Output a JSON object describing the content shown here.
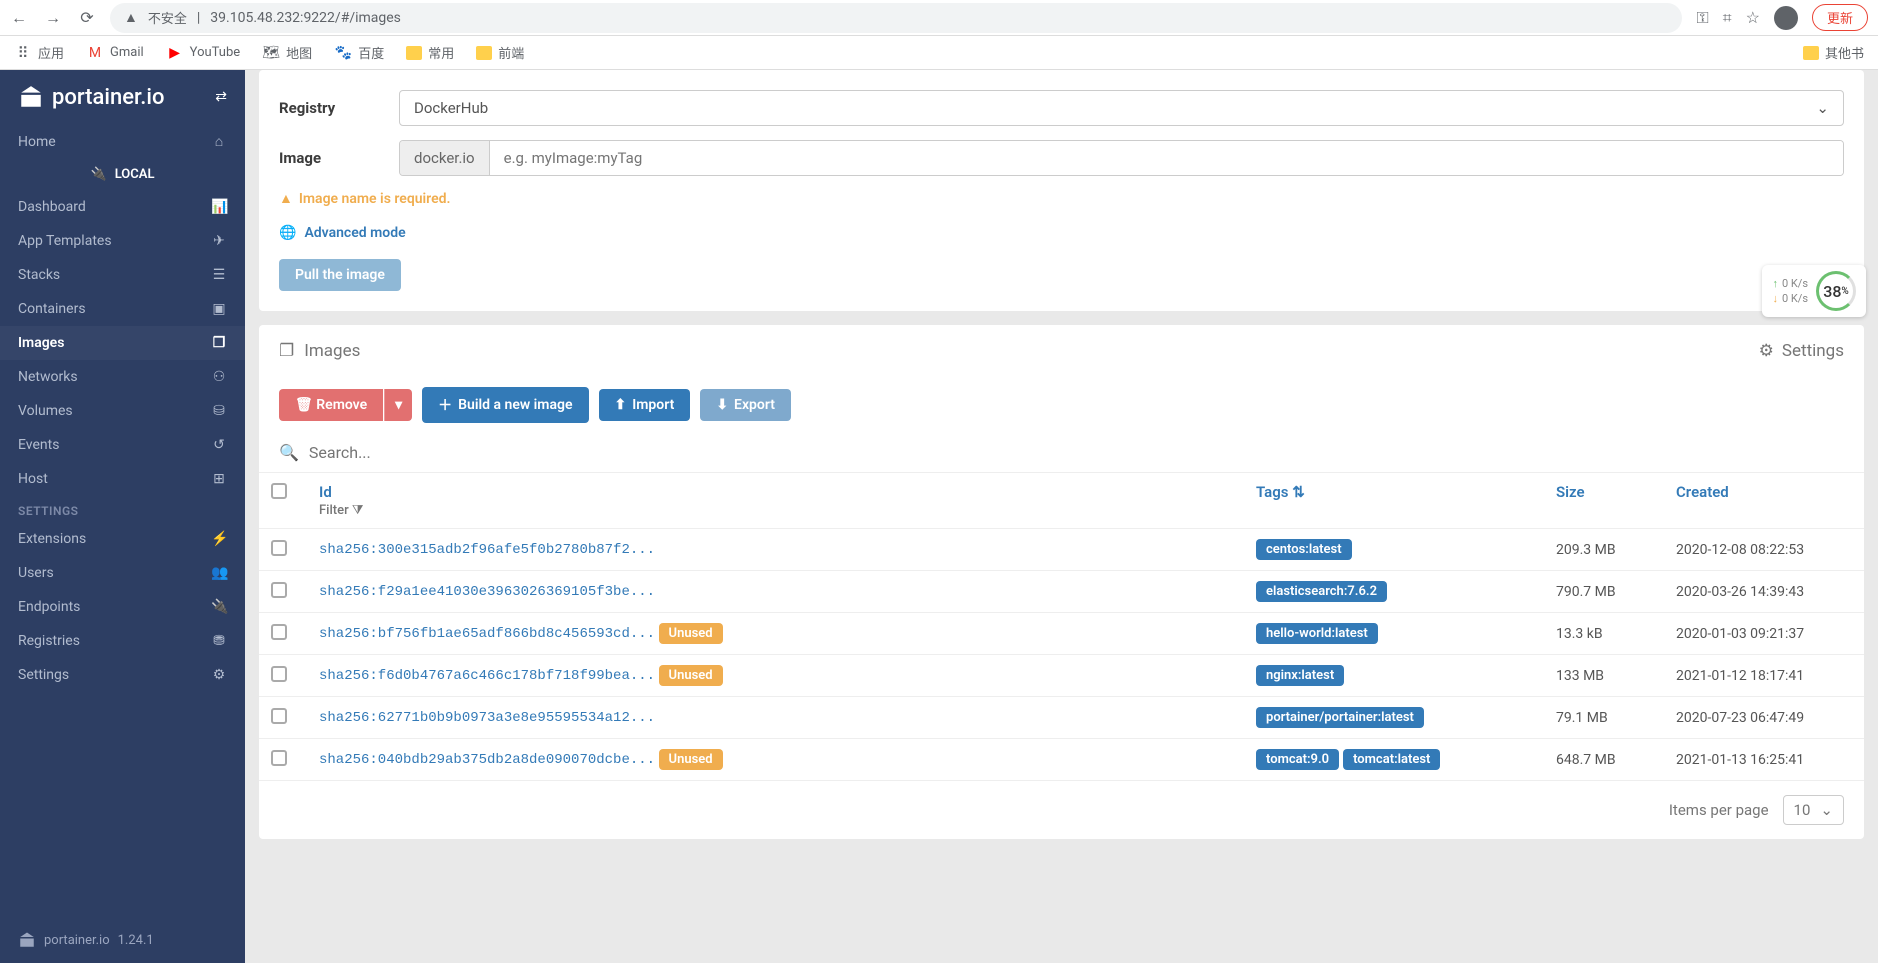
{
  "browser": {
    "url": "39.105.48.232:9222/#/images",
    "insecure_label": "不安全",
    "update_label": "更新"
  },
  "bookmarks": {
    "apps": "应用",
    "gmail": "Gmail",
    "youtube": "YouTube",
    "maps": "地图",
    "baidu": "百度",
    "common": "常用",
    "frontend": "前端",
    "other": "其他书"
  },
  "sidebar": {
    "logo": "portainer.io",
    "home": "Home",
    "local_section": "LOCAL",
    "items": {
      "dashboard": "Dashboard",
      "app_templates": "App Templates",
      "stacks": "Stacks",
      "containers": "Containers",
      "images": "Images",
      "networks": "Networks",
      "volumes": "Volumes",
      "events": "Events",
      "host": "Host"
    },
    "settings_label": "SETTINGS",
    "settings_items": {
      "extensions": "Extensions",
      "users": "Users",
      "endpoints": "Endpoints",
      "registries": "Registries",
      "settings": "Settings"
    },
    "footer_version": "1.24.1"
  },
  "pull_panel": {
    "registry_label": "Registry",
    "registry_value": "DockerHub",
    "image_label": "Image",
    "image_prefix": "docker.io",
    "image_placeholder": "e.g. myImage:myTag",
    "warning": "Image name is required.",
    "advanced": "Advanced mode",
    "pull_button": "Pull the image"
  },
  "images_panel": {
    "title": "Images",
    "settings": "Settings",
    "toolbar": {
      "remove": "Remove",
      "build": "Build a new image",
      "import": "Import",
      "export": "Export"
    },
    "search_placeholder": "Search...",
    "columns": {
      "id": "Id",
      "filter": "Filter",
      "tags": "Tags",
      "size": "Size",
      "created": "Created"
    },
    "rows": [
      {
        "id": "sha256:300e315adb2f96afe5f0b2780b87f2...",
        "unused": false,
        "tags": [
          "centos:latest"
        ],
        "size": "209.3 MB",
        "created": "2020-12-08 08:22:53"
      },
      {
        "id": "sha256:f29a1ee41030e3963026369105f3be...",
        "unused": false,
        "tags": [
          "elasticsearch:7.6.2"
        ],
        "size": "790.7 MB",
        "created": "2020-03-26 14:39:43"
      },
      {
        "id": "sha256:bf756fb1ae65adf866bd8c456593cd...",
        "unused": true,
        "tags": [
          "hello-world:latest"
        ],
        "size": "13.3 kB",
        "created": "2020-01-03 09:21:37"
      },
      {
        "id": "sha256:f6d0b4767a6c466c178bf718f99bea...",
        "unused": true,
        "tags": [
          "nginx:latest"
        ],
        "size": "133 MB",
        "created": "2021-01-12 18:17:41"
      },
      {
        "id": "sha256:62771b0b9b0973a3e8e95595534a12...",
        "unused": false,
        "tags": [
          "portainer/portainer:latest"
        ],
        "size": "79.1 MB",
        "created": "2020-07-23 06:47:49"
      },
      {
        "id": "sha256:040bdb29ab375db2a8de090070dcbe...",
        "unused": true,
        "tags": [
          "tomcat:9.0",
          "tomcat:latest"
        ],
        "size": "648.7 MB",
        "created": "2021-01-13 16:25:41"
      }
    ],
    "unused_label": "Unused",
    "items_per_page": "Items per page",
    "page_size": "10"
  },
  "speed_widget": {
    "up": "0  K/s",
    "down": "0  K/s",
    "percent": "38",
    "percent_suffix": "%"
  }
}
